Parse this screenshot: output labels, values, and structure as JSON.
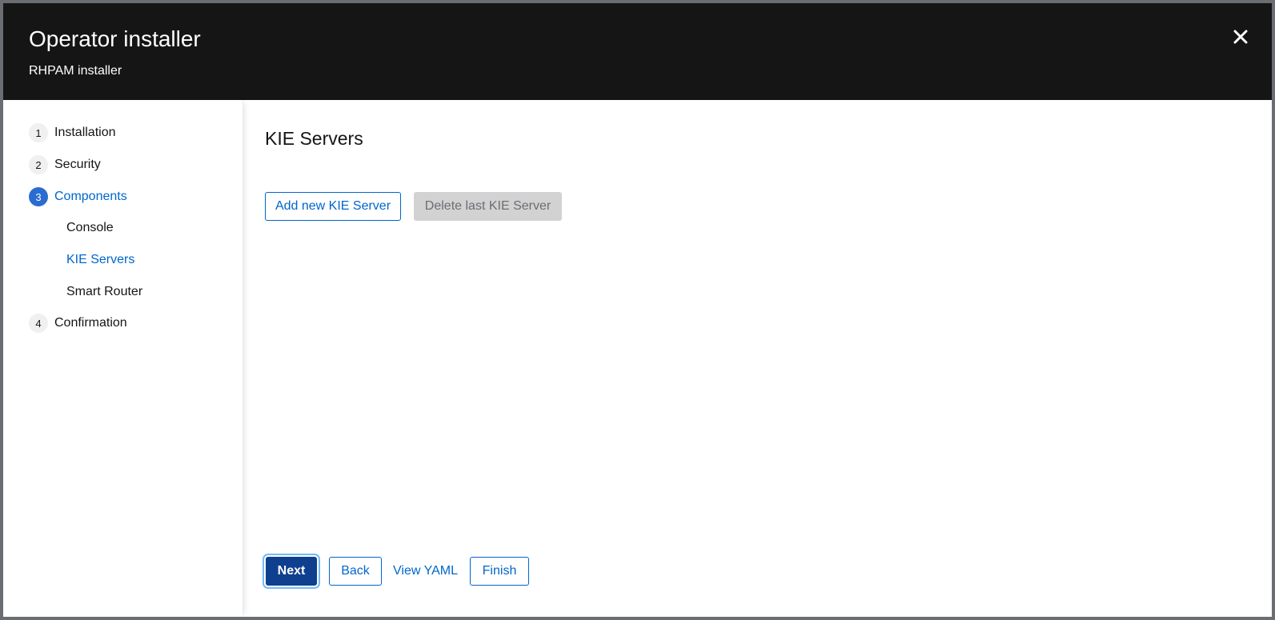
{
  "header": {
    "title": "Operator installer",
    "subtitle": "RHPAM installer"
  },
  "close_icon": "close-icon",
  "nav": {
    "steps": [
      {
        "number": "1",
        "label": "Installation"
      },
      {
        "number": "2",
        "label": "Security"
      },
      {
        "number": "3",
        "label": "Components"
      },
      {
        "number": "4",
        "label": "Confirmation"
      }
    ],
    "substeps": [
      {
        "label": "Console"
      },
      {
        "label": "KIE Servers"
      },
      {
        "label": "Smart Router"
      }
    ],
    "active_step": "Components",
    "active_substep": "KIE Servers"
  },
  "main": {
    "title": "KIE Servers",
    "add_button": "Add new KIE Server",
    "delete_button": "Delete last KIE Server"
  },
  "footer": {
    "next": "Next",
    "back": "Back",
    "view_yaml": "View YAML",
    "finish": "Finish"
  },
  "colors": {
    "header_bg": "#151515",
    "accent": "#0066cc",
    "primary_button": "#0f3f8f",
    "active_step_circle": "#2b6cd1"
  }
}
